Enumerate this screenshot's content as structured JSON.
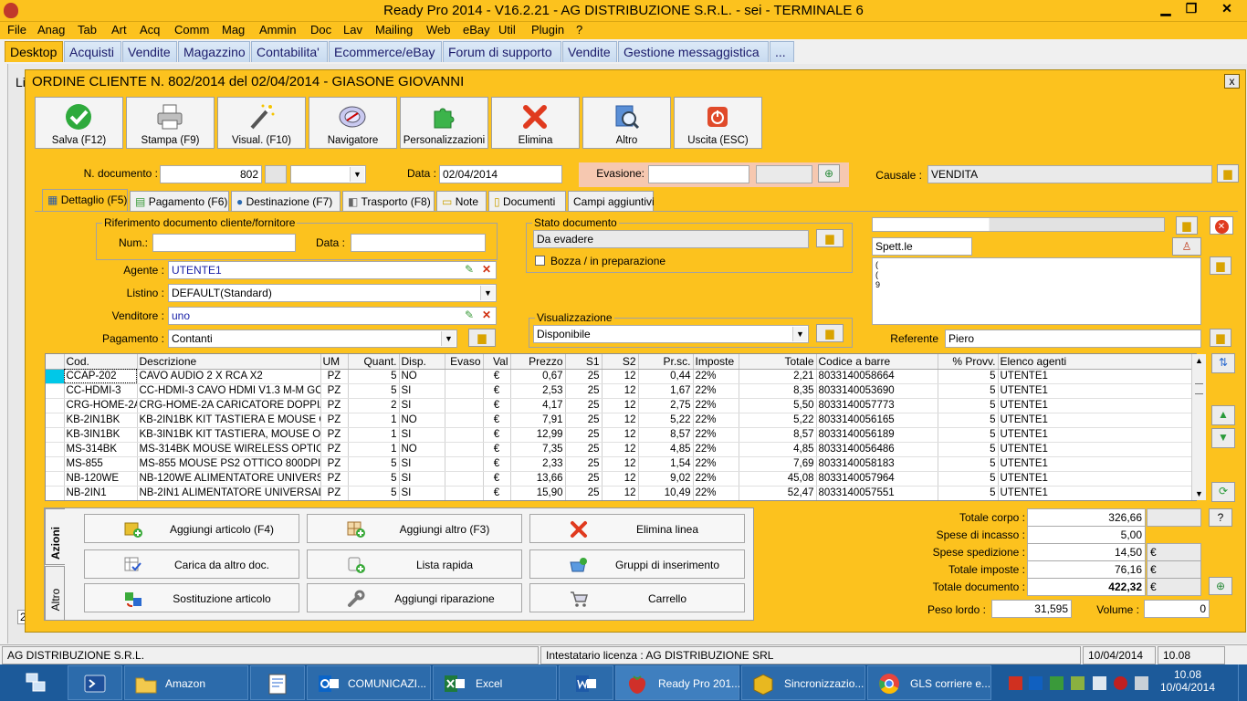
{
  "window": {
    "title": "Ready Pro 2014 - V16.2.21 - AG DISTRIBUZIONE S.R.L. - sei - TERMINALE 6",
    "minimize": "▁",
    "restore": "❐",
    "close": "✕"
  },
  "menu": [
    "File",
    "Anag",
    "Tab",
    "Art",
    "Acq",
    "Comm",
    "Mag",
    "Ammin",
    "Doc",
    "Lav",
    "Mailing",
    "Web",
    "eBay",
    "Util",
    "Plugin",
    "?"
  ],
  "tabs": [
    "Desktop",
    "Acquisti",
    "Vendite",
    "Magazzino",
    "Contabilita'",
    "Ecommerce/eBay",
    "Forum di supporto",
    "Vendite",
    "Gestione messaggistica",
    "..."
  ],
  "bg_letters": {
    "l1": "Li",
    "l2": "2"
  },
  "order": {
    "title": "ORDINE CLIENTE N. 802/2014 del 02/04/2014 - GIASONE GIOVANNI",
    "close": "x",
    "toolbar": [
      "Salva (F12)",
      "Stampa (F9)",
      "Visual. (F10)",
      "Navigatore",
      "Personalizzazioni",
      "Elimina",
      "Altro",
      "Uscita (ESC)"
    ],
    "header": {
      "n_doc_label": "N. documento :",
      "n_doc_value": "802",
      "data_label": "Data :",
      "data_value": "02/04/2014",
      "evasione_label": "Evasione:",
      "causale_label": "Causale :",
      "causale_value": "VENDITA"
    },
    "inner_tabs": [
      "Dettaglio (F5)",
      "Pagamento (F6)",
      "Destinazione (F7)",
      "Trasporto (F8)",
      "Note",
      "Documenti",
      "Campi aggiuntivi"
    ],
    "rif": {
      "legend": "Riferimento documento cliente/fornitore",
      "num_label": "Num.:",
      "data_label": "Data :"
    },
    "agente_label": "Agente :",
    "agente_value": "UTENTE1",
    "listino_label": "Listino :",
    "listino_value": "DEFAULT(Standard)",
    "venditore_label": "Venditore :",
    "venditore_value": "uno",
    "pagamento_label": "Pagamento :",
    "pagamento_value": "Contanti",
    "stato": {
      "legend": "Stato documento",
      "value": "Da evadere",
      "bozza_label": "Bozza / in preparazione"
    },
    "visual": {
      "legend": "Visualizzazione",
      "value": "Disponibile"
    },
    "cliente": {
      "spett_value": "Spett.le",
      "addr_lines": [
        "(",
        "(",
        "9"
      ],
      "referente_label": "Referente",
      "referente_value": "Piero"
    },
    "grid": {
      "columns": [
        "Cod.",
        "Descrizione",
        "UM",
        "Quant.",
        "Disp.",
        "Evaso",
        "Val",
        "Prezzo",
        "S1",
        "S2",
        "Pr.sc.",
        "Imposte",
        "Totale",
        "Codice a barre",
        "% Provv.",
        "Elenco agenti"
      ],
      "rows": [
        [
          "CCAP-202",
          "CAVO AUDIO 2 X RCA X2",
          "PZ",
          "5",
          "NO",
          "",
          "€",
          "0,67",
          "25",
          "12",
          "0,44",
          "22%",
          "2,21",
          "8033140058664",
          "5",
          "UTENTE1"
        ],
        [
          "CC-HDMI-3",
          "CC-HDMI-3 CAVO HDMI V1.3 M-M GO...",
          "PZ",
          "5",
          "SI",
          "",
          "€",
          "2,53",
          "25",
          "12",
          "1,67",
          "22%",
          "8,35",
          "8033140053690",
          "5",
          "UTENTE1"
        ],
        [
          "CRG-HOME-2A",
          "CRG-HOME-2A CARICATORE DOPPIA...",
          "PZ",
          "2",
          "SI",
          "",
          "€",
          "4,17",
          "25",
          "12",
          "2,75",
          "22%",
          "5,50",
          "8033140057773",
          "5",
          "UTENTE1"
        ],
        [
          "KB-2IN1BK",
          "KB-2IN1BK KIT TASTIERA E MOUSE O...",
          "PZ",
          "1",
          "NO",
          "",
          "€",
          "7,91",
          "25",
          "12",
          "5,22",
          "22%",
          "5,22",
          "8033140056165",
          "5",
          "UTENTE1"
        ],
        [
          "KB-3IN1BK",
          "KB-3IN1BK KIT TASTIERA, MOUSE OT...",
          "PZ",
          "1",
          "SI",
          "",
          "€",
          "12,99",
          "25",
          "12",
          "8,57",
          "22%",
          "8,57",
          "8033140056189",
          "5",
          "UTENTE1"
        ],
        [
          "MS-314BK",
          "MS-314BK MOUSE WIRELESS OPTICA...",
          "PZ",
          "1",
          "NO",
          "",
          "€",
          "7,35",
          "25",
          "12",
          "4,85",
          "22%",
          "4,85",
          "8033140056486",
          "5",
          "UTENTE1"
        ],
        [
          "MS-855",
          "MS-855 MOUSE PS2 OTTICO 800DPI ...",
          "PZ",
          "5",
          "SI",
          "",
          "€",
          "2,33",
          "25",
          "12",
          "1,54",
          "22%",
          "7,69",
          "8033140058183",
          "5",
          "UTENTE1"
        ],
        [
          "NB-120WE",
          "NB-120WE  ALIMENTATORE UNIVERS...",
          "PZ",
          "5",
          "SI",
          "",
          "€",
          "13,66",
          "25",
          "12",
          "9,02",
          "22%",
          "45,08",
          "8033140057964",
          "5",
          "UTENTE1"
        ],
        [
          "NB-2IN1",
          "NB-2IN1 ALIMENTATORE UNIVERSAL...",
          "PZ",
          "5",
          "SI",
          "",
          "€",
          "15,90",
          "25",
          "12",
          "10,49",
          "22%",
          "52,47",
          "8033140057551",
          "5",
          "UTENTE1"
        ]
      ]
    },
    "actions": {
      "vtab_azioni": "Azioni",
      "vtab_altro": "Altro",
      "buttons": [
        "Aggiungi articolo (F4)",
        "Aggiungi altro (F3)",
        "Elimina linea",
        "Carica da altro doc.",
        "Lista rapida",
        "Gruppi di inserimento",
        "Sostituzione articolo",
        "Aggiungi riparazione",
        "Carrello"
      ]
    },
    "totals": {
      "corpo_label": "Totale corpo :",
      "corpo_value": "326,66",
      "corpo_btn": "?",
      "incasso_label": "Spese di incasso :",
      "incasso_value": "5,00",
      "spedizione_label": "Spese spedizione :",
      "spedizione_value": "14,50",
      "imposte_label": "Totale imposte :",
      "imposte_value": "76,16",
      "documento_label": "Totale documento :",
      "documento_value": "422,32",
      "currency": "€",
      "peso_label": "Peso lordo :",
      "peso_value": "31,595",
      "volume_label": "Volume :",
      "volume_value": "0"
    }
  },
  "status": {
    "company": "AG DISTRIBUZIONE S.R.L.",
    "license": "Intestatario licenza : AG DISTRIBUZIONE SRL",
    "date": "10/04/2014",
    "time": "10.08"
  },
  "taskbar": {
    "items": [
      "Amazon",
      "COMUNICAZI...",
      "Excel",
      "Ready Pro 201...",
      "Sincronizzazio...",
      "GLS corriere e..."
    ],
    "clock_time": "10.08",
    "clock_date": "10/04/2014"
  },
  "colors": {
    "accent": "#fcc21e",
    "taskbar": "#1c5a9a",
    "selected_cell": "#00c8e8"
  }
}
